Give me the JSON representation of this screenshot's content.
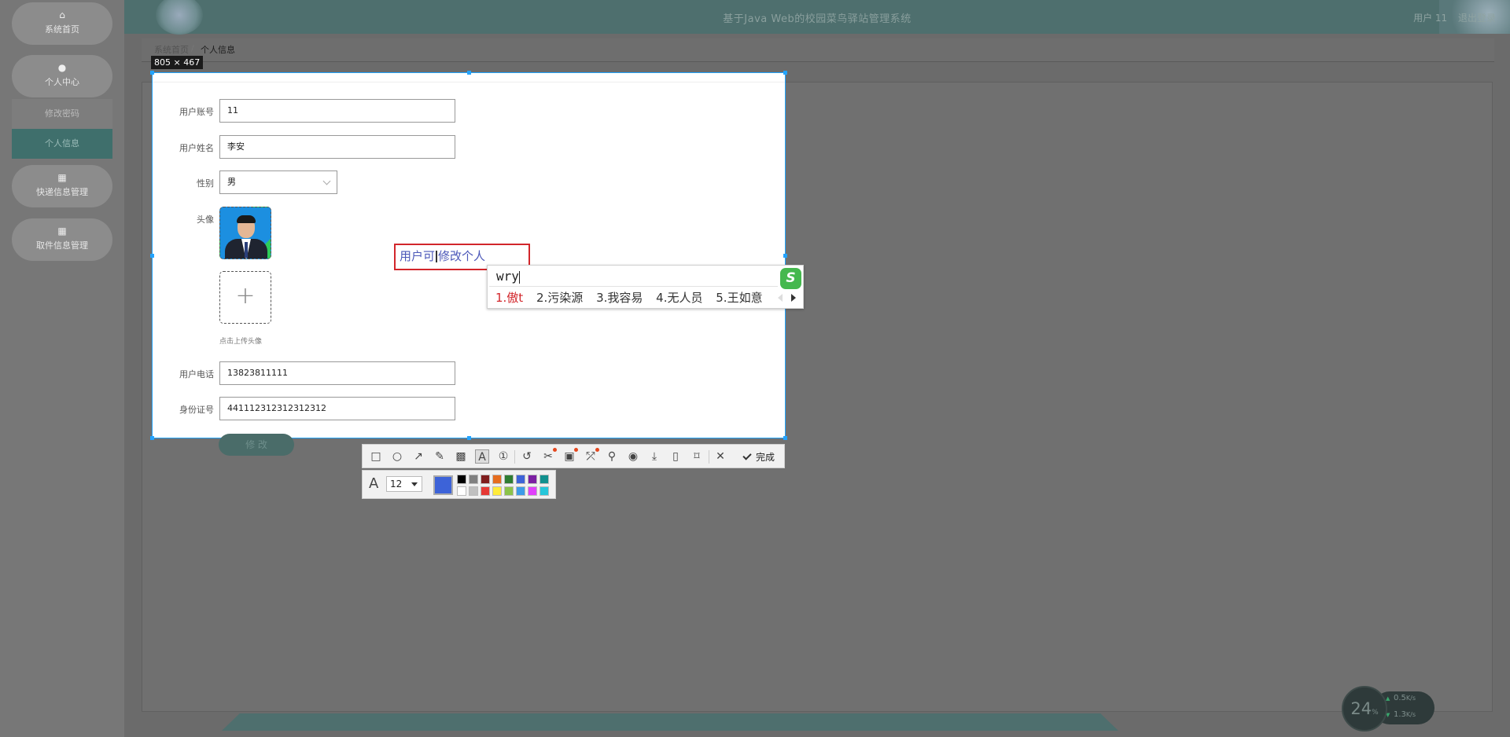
{
  "sidebar": {
    "home_label": "系统首页",
    "profile_label": "个人中心",
    "change_password": "修改密码",
    "personal_info": "个人信息",
    "express_label": "快递信息管理",
    "pickup_label": "取件信息管理"
  },
  "header": {
    "title": "基于Java Web的校园菜鸟驿站管理系统",
    "user": "用户 11",
    "logout": "退出登录"
  },
  "breadcrumb": {
    "home": "系统首页",
    "current": "个人信息"
  },
  "selection": {
    "size_label": "805 × 467"
  },
  "form": {
    "account_label": "用户账号",
    "account_value": "11",
    "name_label": "用户姓名",
    "name_value": "李安",
    "gender_label": "性别",
    "gender_value": "男",
    "avatar_label": "头像",
    "upload_hint": "点击上传头像",
    "phone_label": "用户电话",
    "phone_value": "13823811111",
    "id_label": "身份证号",
    "id_value": "441112312312312312",
    "modify_button": "修 改"
  },
  "annotation": {
    "text_before_cursor": "用户可",
    "text_after_cursor": "修改个人"
  },
  "ime": {
    "composition": "wry",
    "candidates": [
      "1.傲t",
      "2.污染源",
      "3.我容易",
      "4.无人员",
      "5.王如意"
    ],
    "logo_letter": "S"
  },
  "toolbar": {
    "done_label": "完成",
    "tool_icons": [
      "rectangle-icon",
      "ellipse-icon",
      "arrow-icon",
      "pencil-icon",
      "mosaic-icon",
      "text-icon",
      "number-icon",
      "undo-icon",
      "cut-icon",
      "ocr-icon",
      "translate-icon",
      "pin-icon",
      "record-icon",
      "save-icon",
      "mobile-icon",
      "bookmark-icon",
      "close-icon"
    ]
  },
  "text_style": {
    "font_size": "12",
    "current_color": "#3d63d8",
    "palette_top": [
      "#000000",
      "#808080",
      "#7f1d1d",
      "#e66d1f",
      "#2e7d32",
      "#3d63d8",
      "#7b1fa2",
      "#12908e"
    ],
    "palette_bottom": [
      "#ffffff",
      "#c0c0c0",
      "#e53935",
      "#ffeb3b",
      "#8bc34a",
      "#3d9be9",
      "#e040fb",
      "#26c6da"
    ]
  },
  "network": {
    "percent": "24",
    "percent_unit": "%",
    "upload": "0.5",
    "download": "1.3",
    "rate_unit": "K/s"
  }
}
